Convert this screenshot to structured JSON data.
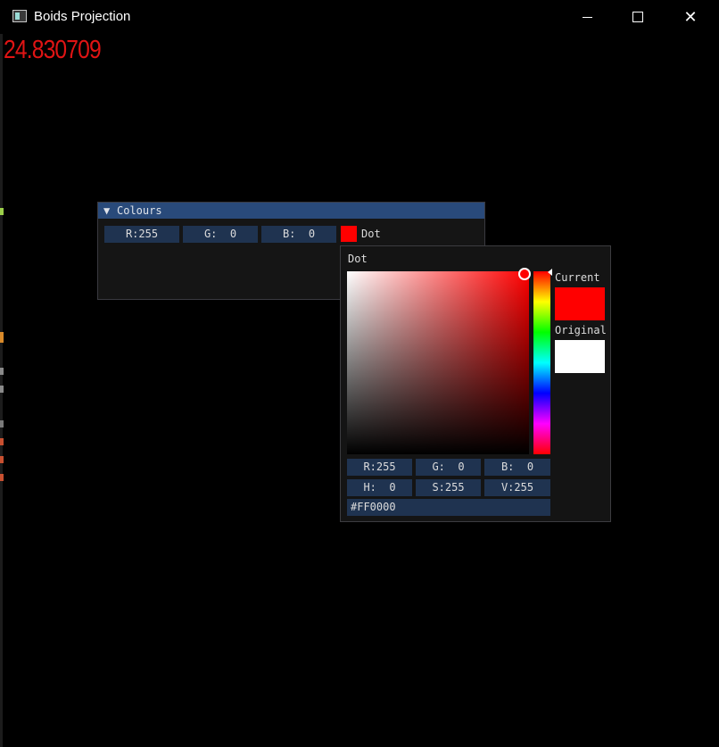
{
  "window": {
    "title": "Boids Projection",
    "close_glyph": "✕"
  },
  "overlay": {
    "fps_value": "24.830709"
  },
  "colours_window": {
    "title": "Colours",
    "collapse_glyph": "▼",
    "r_field": "R:255",
    "g_field": "G:  0",
    "b_field": "B:  0",
    "swatch_color": "#ff0000",
    "label": "Dot"
  },
  "color_picker": {
    "title": "Dot",
    "hue_color": "#ff0000",
    "current_label": "Current",
    "current_color": "#ff0000",
    "original_label": "Original",
    "original_color": "#ffffff",
    "r_field": "R:255",
    "g_field": "G:  0",
    "b_field": "B:  0",
    "h_field": "H:  0",
    "s_field": "S:255",
    "v_field": "V:255",
    "hex_value": "#FF0000"
  },
  "colors": {
    "accent": "#294a7a",
    "field_bg": "#1f3350",
    "fps_text": "#e01414"
  }
}
